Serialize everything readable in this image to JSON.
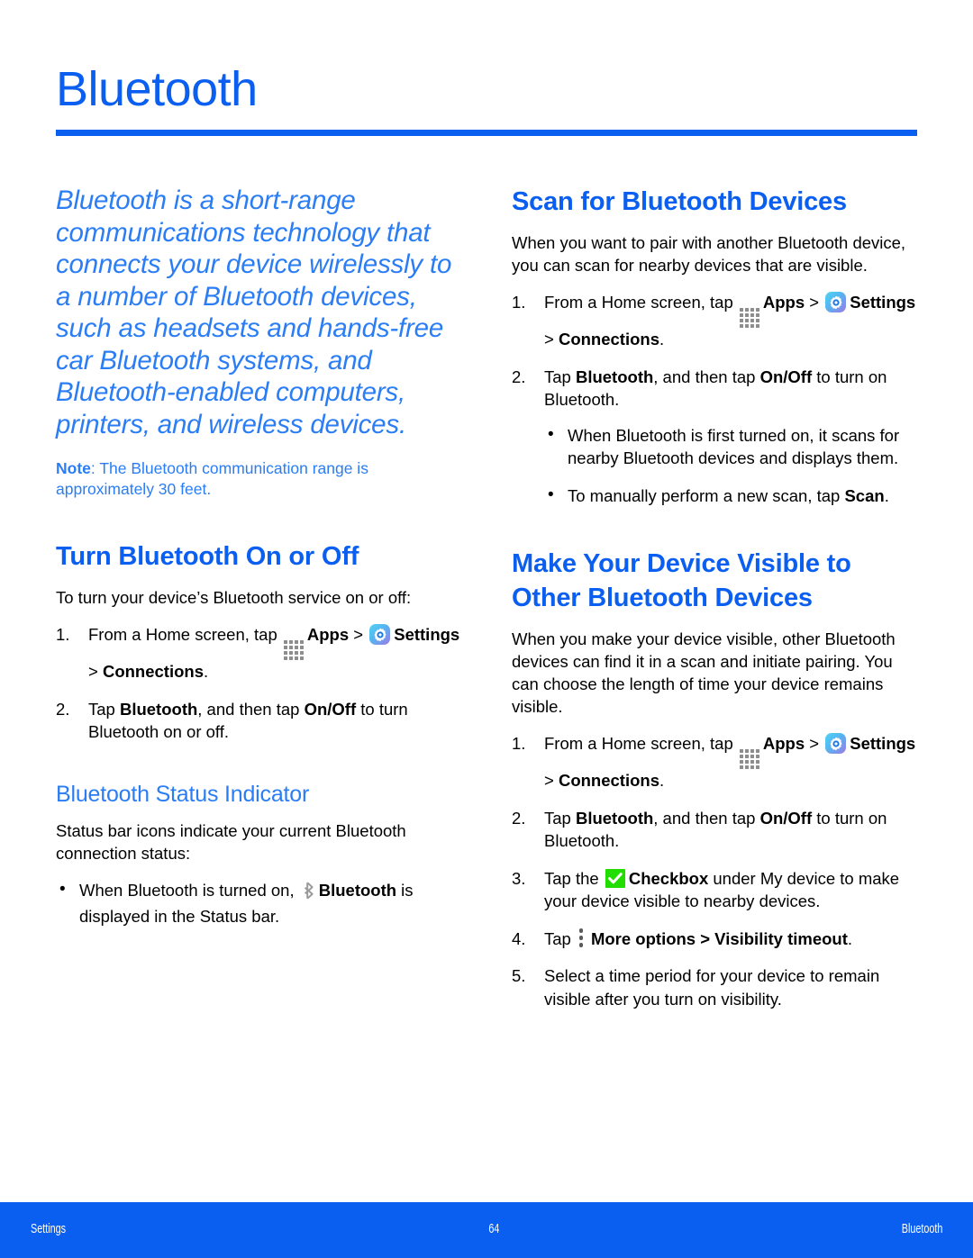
{
  "page": {
    "title": "Bluetooth",
    "accent_color": "#0a5ef0",
    "intro_color": "#2a7df4"
  },
  "left_column": {
    "intro": "Bluetooth is a short-range communications technology that connects your device wirelessly to a number of Bluetooth devices, such as headsets and hands-free car Bluetooth systems, and Bluetooth-enabled computers, printers, and wireless devices.",
    "note": {
      "label": "Note",
      "separator": ": ",
      "text": "The Bluetooth communication range is approximately 30 feet."
    },
    "section": {
      "heading": "Turn Bluetooth On or Off",
      "lead": "To turn your device’s Bluetooth service on or off:",
      "steps": [
        {
          "num": "1.",
          "part1": "From a Home screen, tap ",
          "apps_label": "Apps",
          "sep1": " > ",
          "settings_label": "Settings",
          "sep2": " > ",
          "connections_label": "Connections",
          "end": "."
        },
        {
          "num": "2.",
          "part1": "Tap ",
          "bold1": "Bluetooth",
          "part2": ", and then tap ",
          "bold2": "On/Off",
          "part3": " to turn Bluetooth on or off."
        }
      ]
    },
    "subsection": {
      "heading": "Bluetooth Status Indicator",
      "lead": "Status bar icons indicate your current Bluetooth connection status:",
      "bullets": [
        {
          "part1": "When Bluetooth is turned on, ",
          "bold1": "Bluetooth",
          "part2": " is displayed in the Status bar."
        }
      ]
    }
  },
  "right_column": {
    "scan_section": {
      "heading": "Scan for Bluetooth Devices",
      "lead": "When you want to pair with another Bluetooth device, you can scan for nearby devices that are visible.",
      "steps": [
        {
          "num": "1.",
          "part1": "From a Home screen, tap ",
          "apps_label": "Apps",
          "sep1": " > ",
          "settings_label": "Settings",
          "sep2": " > ",
          "connections_label": "Connections",
          "end": "."
        },
        {
          "num": "2.",
          "part1": "Tap ",
          "bold1": "Bluetooth",
          "part2": ", and then tap ",
          "bold2": "On/Off",
          "part3": " to turn on Bluetooth."
        }
      ],
      "bullets": [
        {
          "text": "When Bluetooth is first turned on, it scans for nearby Bluetooth devices and displays them."
        },
        {
          "part1": "To manually perform a new scan, tap ",
          "bold1": "Scan",
          "part2": "."
        }
      ]
    },
    "visible_section": {
      "heading": "Make Your Device Visible to Other Bluetooth Devices",
      "lead": "When you make your device visible, other Bluetooth devices can find it in a scan and initiate pairing. You can choose the length of time your device remains visible.",
      "steps": [
        {
          "num": "1.",
          "part1": "From a Home screen, tap ",
          "apps_label": "Apps",
          "sep1": " > ",
          "settings_label": "Settings",
          "sep2": " > ",
          "connections_label": "Connections",
          "end": "."
        },
        {
          "num": "2.",
          "part1": "Tap ",
          "bold1": "Bluetooth",
          "part2": ", and then tap ",
          "bold2": "On/Off",
          "part3": " to turn on Bluetooth."
        },
        {
          "num": "3.",
          "part1": "Tap the ",
          "checkbox_label": "Checkbox",
          "part2": " under My device to make your device visible to nearby devices."
        },
        {
          "num": "4.",
          "part1": "Tap ",
          "bold1": "More options > Visibility timeout",
          "part2": "."
        },
        {
          "num": "5.",
          "part1": "Select a time period for your device to remain visible after you turn on visibility."
        }
      ]
    }
  },
  "footer": {
    "left": "Settings",
    "center": "64",
    "right": "Bluetooth"
  },
  "icons": {
    "apps": "apps-grid-icon",
    "settings": "settings-gear-icon",
    "checkbox": "green-checkbox-icon",
    "more_options": "more-options-vertical-dots-icon",
    "bluetooth_status": "bluetooth-glyph-icon"
  }
}
